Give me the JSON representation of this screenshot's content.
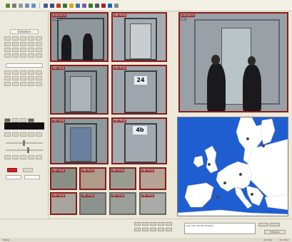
{
  "left_panel": {
    "group_label": "Entrance"
  },
  "cameras": {
    "main": {
      "label": "Entrance",
      "sub": "REC"
    },
    "tile_1": {
      "label": "Entrance",
      "sub": "Entrance"
    },
    "tile_2": {
      "label": "OB Area",
      "sub": ""
    },
    "tile_3": {
      "label": "OB Area",
      "sub": ""
    },
    "tile_4": {
      "label": "OB Area",
      "sub": ""
    },
    "tile_5": {
      "label": "OB Area",
      "sub": ""
    },
    "tile_6": {
      "label": "OB Area",
      "sub": ""
    },
    "sign_24": "24",
    "sign_4b": "4b",
    "thumbs": [
      "OB Area",
      "OB Area",
      "OB Area",
      "OB Area",
      "OB Area",
      "OB Area",
      "OB Area",
      "OB Area"
    ]
  },
  "bottom": {
    "message": "Live view left fist building",
    "entrance_label": "Entrance"
  },
  "status": {
    "left": "Ready",
    "right_1": "Aut Day",
    "right_2": "No Video"
  },
  "colors": {
    "accent": "#8b1a1a",
    "map_water": "#1f5ed1"
  }
}
